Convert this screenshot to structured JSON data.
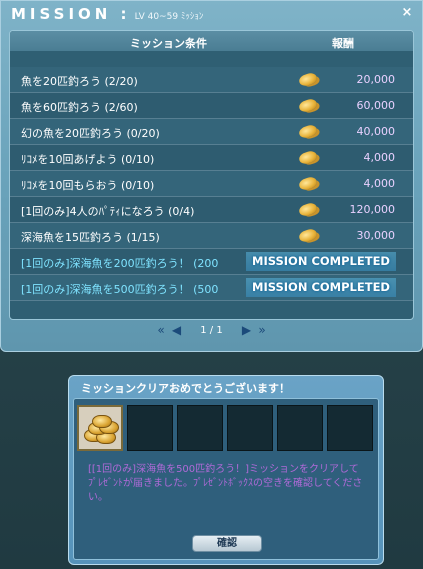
{
  "mission_window": {
    "title": "MISSION :",
    "subtitle": "LV 40~59 ﾐｯｼｮﾝ",
    "close_label": "×",
    "header": {
      "condition": "ミッション条件",
      "reward": "報酬"
    },
    "missions": [
      {
        "condition": "魚を20匹釣ろう (2/20)",
        "reward": "20,000",
        "completed": false
      },
      {
        "condition": "魚を60匹釣ろう (2/60)",
        "reward": "60,000",
        "completed": false
      },
      {
        "condition": "幻の魚を20匹釣ろう (0/20)",
        "reward": "40,000",
        "completed": false
      },
      {
        "condition": "ﾘｺﾒを10回あげよう (0/10)",
        "reward": "4,000",
        "completed": false
      },
      {
        "condition": "ﾘｺﾒを10回もらおう (0/10)",
        "reward": "4,000",
        "completed": false
      },
      {
        "condition": "[1回のみ]4人のﾊﾟﾃｨになろう (0/4)",
        "reward": "120,000",
        "completed": false
      },
      {
        "condition": "深海魚を15匹釣ろう (1/15)",
        "reward": "30,000",
        "completed": false
      },
      {
        "condition": "[1回のみ]深海魚を200匹釣ろう！ (200",
        "reward": "",
        "completed": true,
        "badge": "MISSION COMPLETED"
      },
      {
        "condition": "[1回のみ]深海魚を500匹釣ろう！ (500",
        "reward": "",
        "completed": true,
        "badge": "MISSION COMPLETED"
      }
    ],
    "pager": {
      "first": "«",
      "prev": "◀",
      "page_text": "1 / 1",
      "next": "▶",
      "last": "»"
    }
  },
  "clear_dialog": {
    "title": "ミッションクリアおめでとうございます！",
    "message": "[[1回のみ]深海魚を500匹釣ろう！]ミッションをクリアしてﾌﾟﾚｾﾞﾝﾄが届きました。ﾌﾟﾚｾﾞﾝﾄﾎﾞｯｸｽの空きを確認してください。",
    "confirm_label": "確認",
    "slots": [
      "gold-coins",
      "empty",
      "empty",
      "empty",
      "empty",
      "empty"
    ]
  }
}
